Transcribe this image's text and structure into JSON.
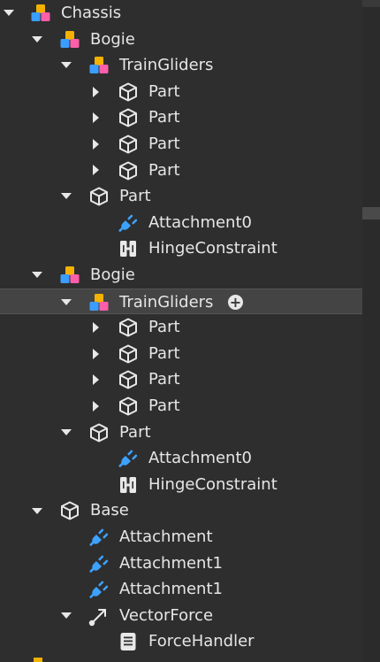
{
  "explorer": {
    "rows": [
      {
        "label": "Chassis",
        "icon": "model-icon",
        "arrow": "down"
      },
      {
        "label": "Bogie",
        "icon": "model-icon",
        "arrow": "down"
      },
      {
        "label": "TrainGliders",
        "icon": "model-icon",
        "arrow": "down"
      },
      {
        "label": "Part",
        "icon": "part-icon",
        "arrow": "right"
      },
      {
        "label": "Part",
        "icon": "part-icon",
        "arrow": "right"
      },
      {
        "label": "Part",
        "icon": "part-icon",
        "arrow": "right"
      },
      {
        "label": "Part",
        "icon": "part-icon",
        "arrow": "right"
      },
      {
        "label": "Part",
        "icon": "part-icon",
        "arrow": "down"
      },
      {
        "label": "Attachment0",
        "icon": "attachment-icon",
        "arrow": "none"
      },
      {
        "label": "HingeConstraint",
        "icon": "hinge-constraint-icon",
        "arrow": "none"
      },
      {
        "label": "Bogie",
        "icon": "model-icon",
        "arrow": "down"
      },
      {
        "label": "TrainGliders",
        "icon": "model-icon",
        "arrow": "down",
        "highlighted": true,
        "add_button": "+"
      },
      {
        "label": "Part",
        "icon": "part-icon",
        "arrow": "right"
      },
      {
        "label": "Part",
        "icon": "part-icon",
        "arrow": "right"
      },
      {
        "label": "Part",
        "icon": "part-icon",
        "arrow": "right"
      },
      {
        "label": "Part",
        "icon": "part-icon",
        "arrow": "right"
      },
      {
        "label": "Part",
        "icon": "part-icon",
        "arrow": "down"
      },
      {
        "label": "Attachment0",
        "icon": "attachment-icon",
        "arrow": "none"
      },
      {
        "label": "HingeConstraint",
        "icon": "hinge-constraint-icon",
        "arrow": "none"
      },
      {
        "label": "Base",
        "icon": "part-icon",
        "arrow": "down"
      },
      {
        "label": "Attachment",
        "icon": "attachment-icon",
        "arrow": "none"
      },
      {
        "label": "Attachment1",
        "icon": "attachment-icon",
        "arrow": "none"
      },
      {
        "label": "Attachment1",
        "icon": "attachment-icon",
        "arrow": "none"
      },
      {
        "label": "VectorForce",
        "icon": "vector-force-icon",
        "arrow": "down"
      },
      {
        "label": "ForceHandler",
        "icon": "script-icon",
        "arrow": "none"
      }
    ]
  },
  "colors": {
    "background": "#2e2e2e",
    "highlight": "#444444",
    "text": "#e6e6e6",
    "attachment_blue": "#3da2ff",
    "model_yellow": "#f5b100",
    "model_blue": "#3b9dff",
    "model_pink": "#ff5fa9"
  }
}
